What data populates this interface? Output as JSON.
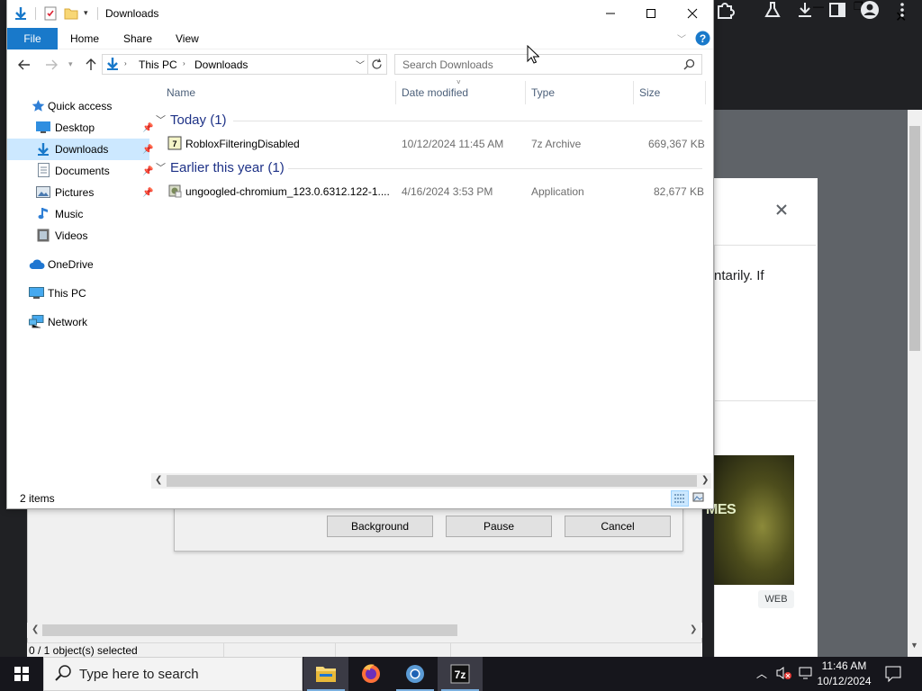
{
  "explorer": {
    "title": "Downloads",
    "window_buttons": {
      "minimize": "minimize",
      "maximize": "maximize",
      "close": "close"
    },
    "ribbon": {
      "file": "File",
      "home": "Home",
      "share": "Share",
      "view": "View"
    },
    "breadcrumb": [
      "This PC",
      "Downloads"
    ],
    "search_placeholder": "Search Downloads",
    "columns": {
      "name": "Name",
      "date": "Date modified",
      "type": "Type",
      "size": "Size"
    },
    "groups": [
      {
        "label": "Today (1)",
        "files": [
          {
            "name": "RobloxFilteringDisabled",
            "date": "10/12/2024 11:45 AM",
            "type": "7z Archive",
            "size": "669,367 KB"
          }
        ]
      },
      {
        "label": "Earlier this year (1)",
        "files": [
          {
            "name": "ungoogled-chromium_123.0.6312.122-1....",
            "date": "4/16/2024 3:53 PM",
            "type": "Application",
            "size": "82,677 KB"
          }
        ]
      }
    ],
    "sidebar": {
      "quick_access": "Quick access",
      "desktop": "Desktop",
      "downloads": "Downloads",
      "documents": "Documents",
      "pictures": "Pictures",
      "music": "Music",
      "videos": "Videos",
      "onedrive": "OneDrive",
      "this_pc": "This PC",
      "network": "Network"
    },
    "status": "2 items",
    "accent": "#1979ca"
  },
  "zip_dialog": {
    "buttons": {
      "background": "Background",
      "pause": "Pause",
      "cancel": "Cancel"
    },
    "status": "0 / 1 object(s) selected"
  },
  "browser": {
    "card_text": "ntarily. If",
    "thumb_text": "MES",
    "badge": "WEB"
  },
  "taskbar": {
    "search_placeholder": "Type here to search",
    "time": "11:46 AM",
    "date": "10/12/2024"
  }
}
